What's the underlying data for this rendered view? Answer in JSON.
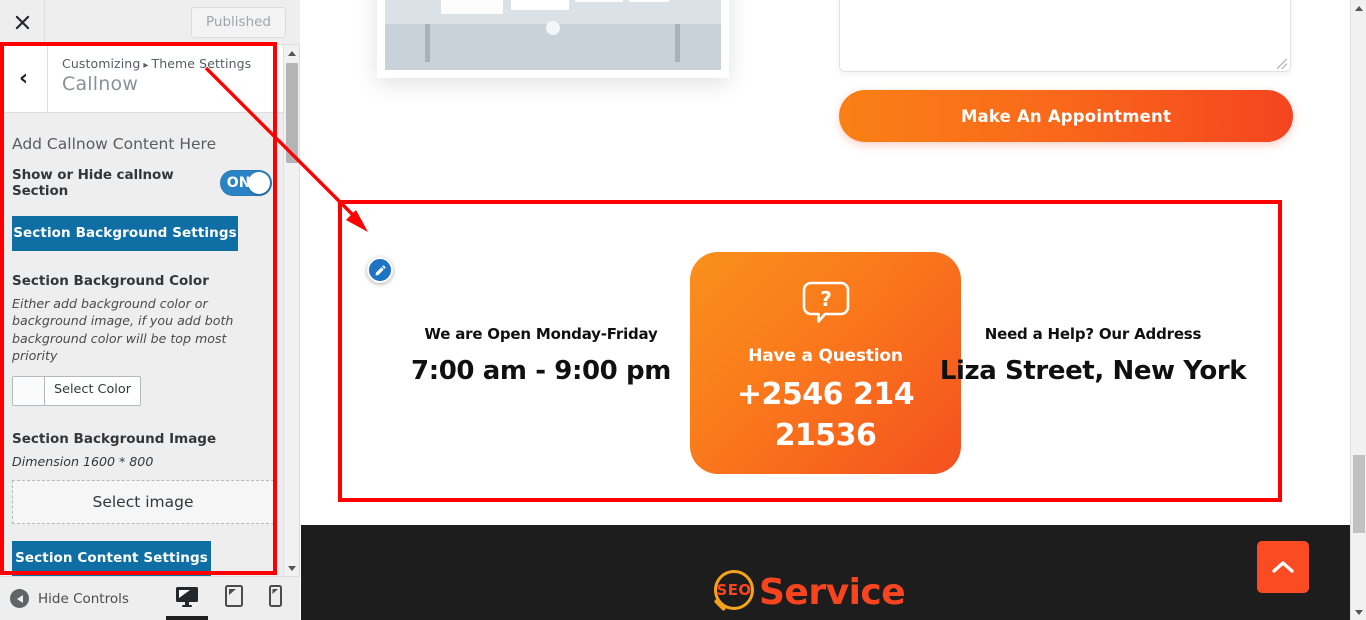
{
  "customizer": {
    "close_icon": "close-x-icon",
    "publish_button": "Published",
    "back_icon": "chevron-left-icon",
    "breadcrumb_root": "Customizing",
    "breadcrumb_separator": "▸",
    "breadcrumb_parent": "Theme Settings",
    "panel_title": "Callnow",
    "group_title": "Add Callnow Content Here",
    "toggle": {
      "label": "Show or Hide callnow Section",
      "state": "ON",
      "accent_color": "#2a83c4"
    },
    "background_settings_button": "Section Background Settings",
    "background_color": {
      "label": "Section Background Color",
      "description": "Either add background color or background image, if you add both background color will be top most priority",
      "picker_label": "Select Color",
      "swatch_color": "#fbfbfb"
    },
    "background_image": {
      "label": "Section Background Image",
      "dimension_note": "Dimension 1600 * 800",
      "select_label": "Select image"
    },
    "content_settings_button": "Section Content Settings",
    "button_color": "#0f6fa5",
    "footer": {
      "hide_controls": "Hide Controls",
      "devices": [
        {
          "name": "desktop",
          "active": true
        },
        {
          "name": "tablet",
          "active": false
        },
        {
          "name": "mobile",
          "active": false
        }
      ]
    }
  },
  "preview": {
    "appointment_button": "Make An Appointment",
    "appointment_textarea_value": "",
    "appointment_textarea_placeholder": "",
    "callnow": {
      "left": {
        "heading": "We are Open Monday-Friday",
        "value": "7:00 am - 9:00 pm"
      },
      "card": {
        "icon": "question-speech-bubble-icon",
        "heading": "Have a Question",
        "phone": "+2546 214 21536",
        "gradient_from": "#f9901c",
        "gradient_to": "#f4501f"
      },
      "right": {
        "heading": "Need a Help? Our Address",
        "value": "Liza Street, New York"
      },
      "edit_shortcut_icon": "edit-pencil-icon"
    },
    "footer": {
      "logo_badge": "SEO",
      "logo_word": "Service",
      "logo_badge_color": "#f9451f",
      "logo_ring_color": "#f5a31a",
      "background_color": "#1d1d1d"
    },
    "back_to_top_icon": "chevron-up-icon",
    "back_to_top_color": "#fa4b23"
  },
  "annotations": {
    "highlight_color": "#fe0000",
    "panel_box_label": "customizer-panel-highlight",
    "section_box_label": "callnow-section-highlight",
    "arrow_label": "pointer-arrow"
  }
}
